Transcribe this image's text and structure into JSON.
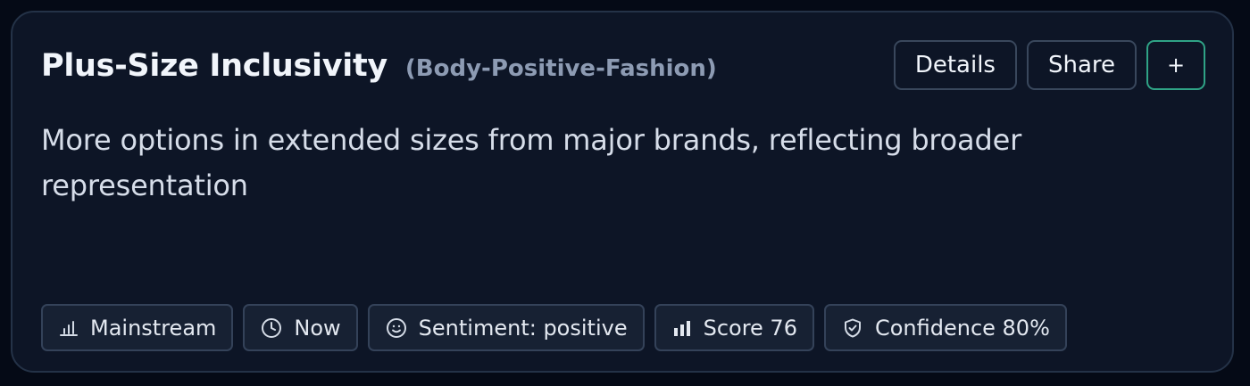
{
  "card": {
    "title": "Plus-Size Inclusivity",
    "category": "(Body-Positive-Fashion)",
    "description": "More options in extended sizes from major brands, reflecting broader representation"
  },
  "actions": {
    "details_label": "Details",
    "share_label": "Share",
    "add_label": "+"
  },
  "chips": [
    {
      "icon": "bar-chart-outline-icon",
      "label": "Mainstream"
    },
    {
      "icon": "clock-icon",
      "label": "Now"
    },
    {
      "icon": "smiley-icon",
      "label": "Sentiment: positive"
    },
    {
      "icon": "bar-chart-filled-icon",
      "label": "Score 76"
    },
    {
      "icon": "shield-check-icon",
      "label": "Confidence 80%"
    }
  ],
  "colors": {
    "background": "#050a16",
    "card": "#0d1526",
    "accent_border": "#2fa386",
    "title": "#f1f5fb",
    "subtitle": "#8d9bb3"
  }
}
